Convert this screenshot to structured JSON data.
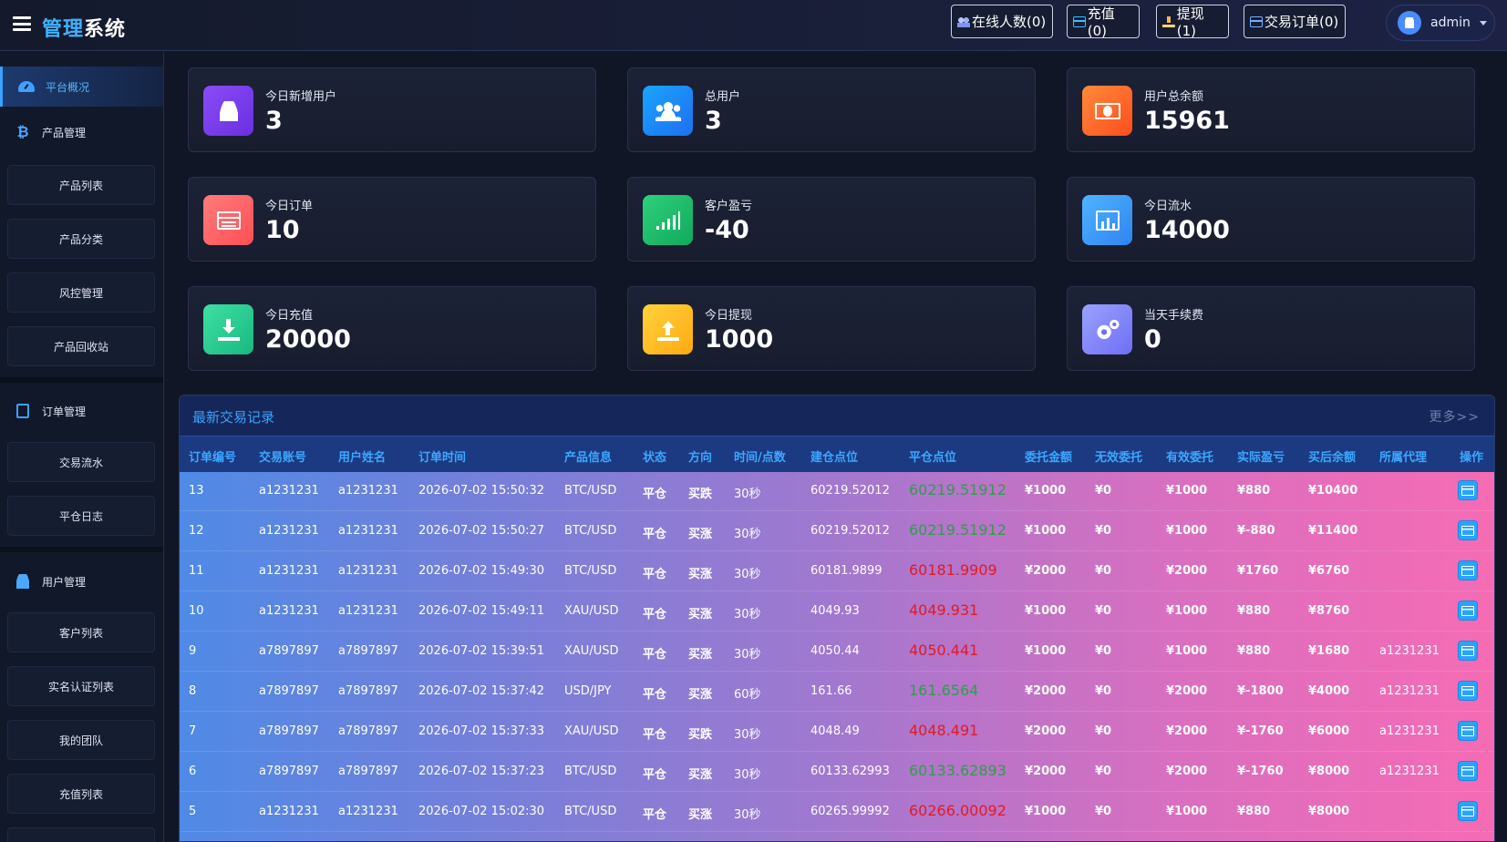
{
  "header": {
    "logo_part1": "管理",
    "logo_part2": "系统",
    "buttons": {
      "online": "在线人数(0)",
      "recharge": "充值(0)",
      "withdraw": "提现(1)",
      "orders": "交易订单(0)"
    },
    "username": "admin"
  },
  "sidebar": {
    "overview": "平台概况",
    "product_group": "产品管理",
    "product_items": [
      "产品列表",
      "产品分类",
      "风控管理",
      "产品回收站"
    ],
    "order_group": "订单管理",
    "order_items": [
      "交易流水",
      "平仓日志"
    ],
    "user_group": "用户管理",
    "user_items": [
      "客户列表",
      "实名认证列表",
      "我的团队",
      "充值列表"
    ]
  },
  "stats": [
    {
      "label": "今日新增用户",
      "value": "3",
      "icon": "user-icon"
    },
    {
      "label": "总用户",
      "value": "3",
      "icon": "users-icon"
    },
    {
      "label": "用户总余额",
      "value": "15961",
      "icon": "money-icon"
    },
    {
      "label": "今日订单",
      "value": "10",
      "icon": "list-icon"
    },
    {
      "label": "客户盈亏",
      "value": "-40",
      "icon": "signal-bars-icon"
    },
    {
      "label": "今日流水",
      "value": "14000",
      "icon": "bar-chart-icon"
    },
    {
      "label": "今日充值",
      "value": "20000",
      "icon": "download-icon"
    },
    {
      "label": "今日提现",
      "value": "1000",
      "icon": "upload-icon"
    },
    {
      "label": "当天手续费",
      "value": "0",
      "icon": "gears-icon"
    }
  ],
  "trades": {
    "title": "最新交易记录",
    "more": "更多>>",
    "columns": [
      "订单编号",
      "交易账号",
      "用户姓名",
      "订单时间",
      "产品信息",
      "状态",
      "方向",
      "时间/点数",
      "建仓点位",
      "平仓点位",
      "委托金额",
      "无效委托",
      "有效委托",
      "实际盈亏",
      "买后余额",
      "所属代理",
      "操作"
    ],
    "colors": {
      "close_up": "#2e9e4a",
      "close_down": "#e01b24"
    },
    "rows": [
      [
        "13",
        "a1231231",
        "a1231231",
        "2026-07-02 15:50:32",
        "BTC/USD",
        "平仓",
        "买跌",
        "30秒",
        "60219.52012",
        "60219.51912",
        "¥1000",
        "¥0",
        "¥1000",
        "¥880",
        "¥10400",
        ""
      ],
      [
        "12",
        "a1231231",
        "a1231231",
        "2026-07-02 15:50:27",
        "BTC/USD",
        "平仓",
        "买涨",
        "30秒",
        "60219.52012",
        "60219.51912",
        "¥1000",
        "¥0",
        "¥1000",
        "¥-880",
        "¥11400",
        ""
      ],
      [
        "11",
        "a1231231",
        "a1231231",
        "2026-07-02 15:49:30",
        "BTC/USD",
        "平仓",
        "买涨",
        "30秒",
        "60181.9899",
        "60181.9909",
        "¥2000",
        "¥0",
        "¥2000",
        "¥1760",
        "¥6760",
        ""
      ],
      [
        "10",
        "a1231231",
        "a1231231",
        "2026-07-02 15:49:11",
        "XAU/USD",
        "平仓",
        "买涨",
        "30秒",
        "4049.93",
        "4049.931",
        "¥1000",
        "¥0",
        "¥1000",
        "¥880",
        "¥8760",
        ""
      ],
      [
        "9",
        "a7897897",
        "a7897897",
        "2026-07-02 15:39:51",
        "XAU/USD",
        "平仓",
        "买涨",
        "30秒",
        "4050.44",
        "4050.441",
        "¥1000",
        "¥0",
        "¥1000",
        "¥880",
        "¥1680",
        "a1231231"
      ],
      [
        "8",
        "a7897897",
        "a7897897",
        "2026-07-02 15:37:42",
        "USD/JPY",
        "平仓",
        "买涨",
        "60秒",
        "161.66",
        "161.6564",
        "¥2000",
        "¥0",
        "¥2000",
        "¥-1800",
        "¥4000",
        "a1231231"
      ],
      [
        "7",
        "a7897897",
        "a7897897",
        "2026-07-02 15:37:33",
        "XAU/USD",
        "平仓",
        "买跌",
        "30秒",
        "4048.49",
        "4048.491",
        "¥2000",
        "¥0",
        "¥2000",
        "¥-1760",
        "¥6000",
        "a1231231"
      ],
      [
        "6",
        "a7897897",
        "a7897897",
        "2026-07-02 15:37:23",
        "BTC/USD",
        "平仓",
        "买涨",
        "30秒",
        "60133.62993",
        "60133.62893",
        "¥2000",
        "¥0",
        "¥2000",
        "¥-1760",
        "¥8000",
        "a1231231"
      ],
      [
        "5",
        "a1231231",
        "a1231231",
        "2026-07-02 15:02:30",
        "BTC/USD",
        "平仓",
        "买涨",
        "30秒",
        "60265.99992",
        "60266.00092",
        "¥1000",
        "¥0",
        "¥1000",
        "¥880",
        "¥8000",
        ""
      ]
    ],
    "close_color_keys": [
      "up",
      "up",
      "down",
      "down",
      "down",
      "up",
      "down",
      "up",
      "down"
    ]
  }
}
